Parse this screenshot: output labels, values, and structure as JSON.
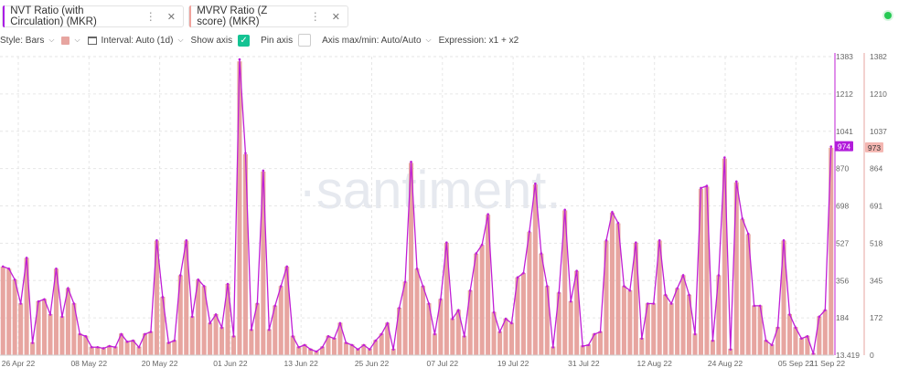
{
  "tabs": [
    {
      "label": "NVT Ratio (with Circulation) (MKR)",
      "color": "#a91ee6"
    },
    {
      "label": "MVRV Ratio (Z score) (MKR)",
      "color": "#f0a29c"
    }
  ],
  "toolbar": {
    "style_label": "Style: Bars",
    "interval_label": "Interval: Auto (1d)",
    "show_axis_label": "Show axis",
    "pin_axis_label": "Pin axis",
    "axis_maxmin_label": "Axis max/min: Auto/Auto",
    "expression_label": "Expression: x1 + x2"
  },
  "icons": {
    "tab_menu": "kebab-menu-icon",
    "tab_close": "close-icon",
    "interval": "calendar-icon",
    "chevron": "chevron-down-icon",
    "check": "check-icon"
  },
  "watermark": "·santiment.",
  "chart_data": {
    "type": "bar",
    "x_ticks": [
      "26 Apr 22",
      "08 May 22",
      "20 May 22",
      "01 Jun 22",
      "13 Jun 22",
      "25 Jun 22",
      "07 Jul 22",
      "19 Jul 22",
      "31 Jul 22",
      "12 Aug 22",
      "24 Aug 22",
      "05 Sep 22",
      "11 Sep 22"
    ],
    "series": [
      {
        "name": "NVT Ratio (with Circulation) (MKR)",
        "color": "#c01fd6",
        "display": "line",
        "axis_ticks": [
          "1383",
          "1212",
          "1041",
          "870",
          "698",
          "527",
          "356",
          "184",
          "13.419"
        ],
        "ylim": [
          13.419,
          1383
        ],
        "last_value": "974",
        "values": [
          420,
          410,
          360,
          250,
          460,
          70,
          260,
          270,
          200,
          410,
          190,
          320,
          250,
          110,
          100,
          50,
          50,
          45,
          55,
          50,
          110,
          75,
          80,
          50,
          110,
          120,
          540,
          280,
          70,
          80,
          380,
          540,
          190,
          360,
          330,
          160,
          200,
          140,
          340,
          100,
          1370,
          940,
          130,
          250,
          860,
          130,
          240,
          330,
          420,
          100,
          50,
          60,
          40,
          30,
          50,
          100,
          90,
          160,
          70,
          60,
          40,
          60,
          40,
          80,
          110,
          160,
          40,
          230,
          350,
          900,
          410,
          330,
          250,
          110,
          270,
          530,
          180,
          220,
          100,
          310,
          480,
          520,
          660,
          210,
          120,
          180,
          160,
          370,
          390,
          580,
          800,
          480,
          330,
          50,
          300,
          680,
          260,
          400,
          55,
          60,
          110,
          120,
          540,
          670,
          620,
          330,
          310,
          530,
          90,
          250,
          250,
          540,
          290,
          250,
          320,
          380,
          290,
          110,
          780,
          790,
          80,
          380,
          920,
          40,
          810,
          640,
          570,
          240,
          240,
          80,
          60,
          140,
          540,
          200,
          140,
          90,
          100,
          20,
          190,
          220,
          970
        ]
      },
      {
        "name": "MVRV Ratio (Z score) (MKR)",
        "color": "#e7a5a0",
        "display": "bars",
        "axis_ticks": [
          "1382",
          "1210",
          "1037",
          "864",
          "691",
          "518",
          "345",
          "172",
          "0"
        ],
        "ylim": [
          0,
          1382
        ],
        "last_value": "973",
        "values": [
          410,
          400,
          350,
          240,
          450,
          60,
          250,
          260,
          190,
          400,
          180,
          310,
          240,
          100,
          90,
          40,
          40,
          35,
          45,
          40,
          100,
          65,
          70,
          40,
          100,
          110,
          530,
          270,
          60,
          70,
          370,
          530,
          180,
          350,
          320,
          150,
          190,
          130,
          330,
          90,
          1360,
          930,
          120,
          240,
          850,
          120,
          230,
          320,
          410,
          90,
          40,
          50,
          30,
          20,
          40,
          90,
          80,
          150,
          60,
          50,
          30,
          50,
          30,
          70,
          100,
          150,
          30,
          220,
          340,
          890,
          400,
          320,
          240,
          100,
          260,
          520,
          170,
          210,
          90,
          300,
          470,
          510,
          650,
          200,
          110,
          170,
          150,
          360,
          380,
          570,
          790,
          470,
          320,
          40,
          290,
          670,
          250,
          390,
          45,
          50,
          100,
          110,
          530,
          660,
          610,
          320,
          300,
          520,
          80,
          240,
          240,
          530,
          280,
          240,
          310,
          370,
          280,
          100,
          770,
          780,
          70,
          370,
          910,
          30,
          800,
          630,
          560,
          230,
          230,
          70,
          50,
          130,
          530,
          190,
          130,
          80,
          90,
          10,
          180,
          210,
          960
        ]
      }
    ],
    "grid": true,
    "legend": "top-left tabs"
  }
}
